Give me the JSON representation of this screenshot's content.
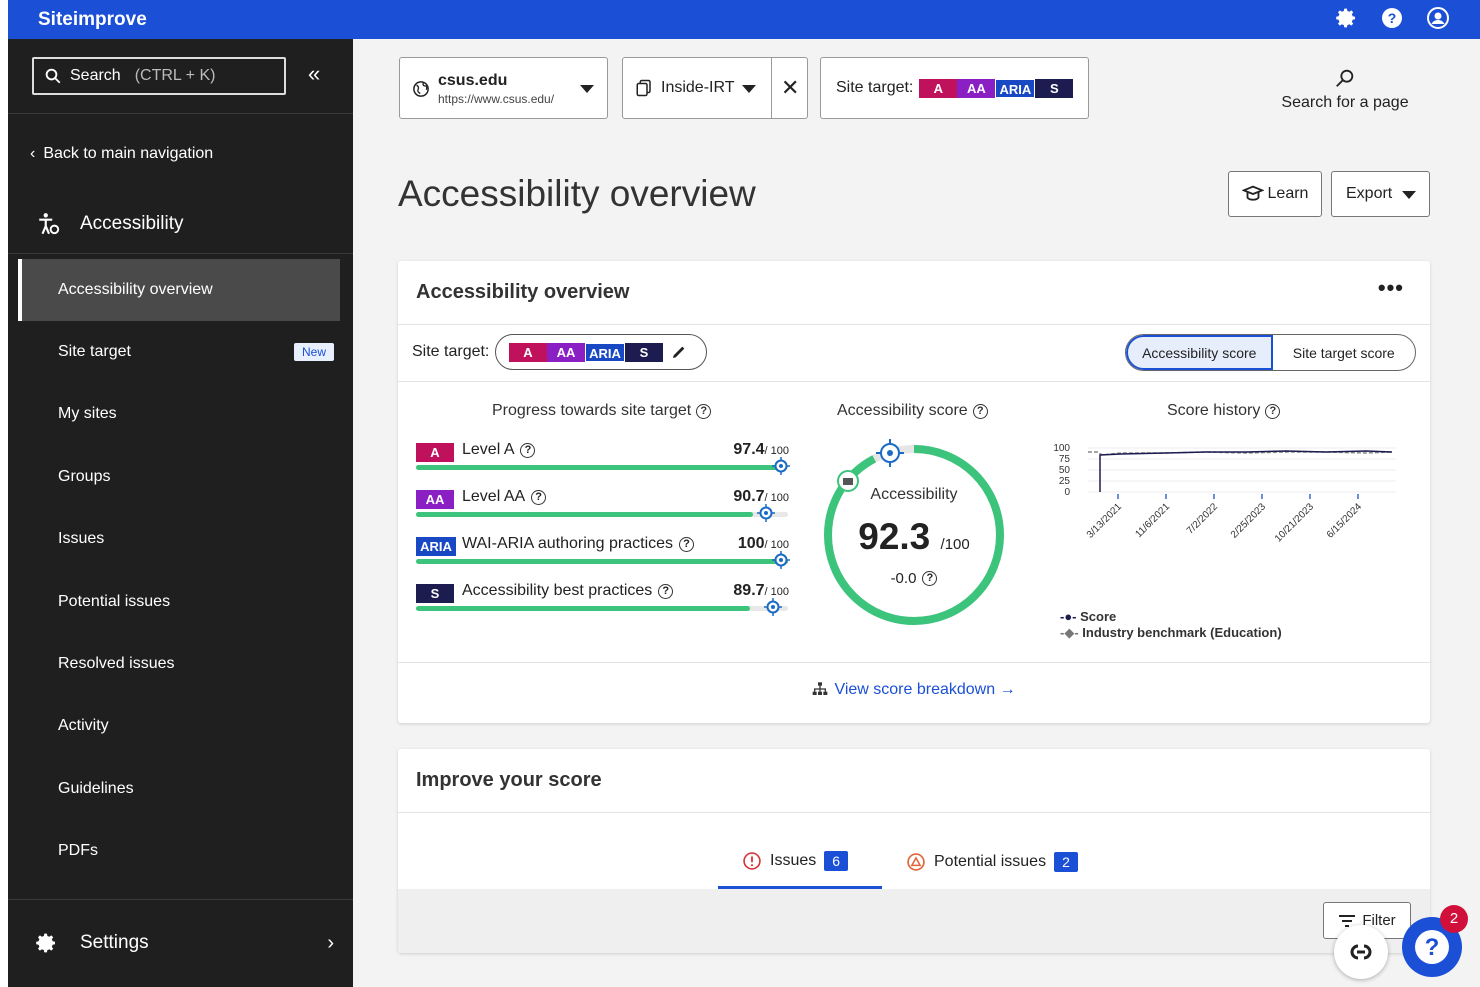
{
  "app": {
    "brand": "Siteimprove"
  },
  "topbar": {
    "icons": [
      "gear-icon",
      "help-icon",
      "account-icon"
    ]
  },
  "sidebar": {
    "search_label": "Search",
    "search_hint": "(CTRL + K)",
    "back_label": "Back to main navigation",
    "section_title": "Accessibility",
    "items": [
      {
        "label": "Accessibility overview",
        "active": true
      },
      {
        "label": "Site target",
        "badge": "New"
      },
      {
        "label": "My sites"
      },
      {
        "label": "Groups"
      },
      {
        "label": "Issues"
      },
      {
        "label": "Potential issues"
      },
      {
        "label": "Resolved issues"
      },
      {
        "label": "Activity"
      },
      {
        "label": "Guidelines"
      },
      {
        "label": "PDFs"
      }
    ],
    "settings_label": "Settings"
  },
  "header": {
    "site_name": "csus.edu",
    "site_url": "https://www.csus.edu/",
    "group_name": "Inside-IRT",
    "site_target_label": "Site target:",
    "tags": [
      "A",
      "AA",
      "ARIA",
      "S"
    ],
    "search_page": "Search for a page"
  },
  "page": {
    "title": "Accessibility overview",
    "learn_label": "Learn",
    "export_label": "Export"
  },
  "overview_card": {
    "title": "Accessibility overview",
    "more": "•••",
    "site_target_label": "Site target:",
    "toggle": [
      "Accessibility score",
      "Site target score"
    ],
    "progress_title": "Progress towards site target",
    "progress": [
      {
        "tag": "A",
        "label": "Level A",
        "value": "97.4",
        "max": "/ 100",
        "fraction": 0.974,
        "target": 0.98
      },
      {
        "tag": "AA",
        "label": "Level AA",
        "value": "90.7",
        "max": "/ 100",
        "fraction": 0.907,
        "target": 0.94
      },
      {
        "tag": "ARIA",
        "label": "WAI-ARIA authoring practices",
        "value": "100",
        "max": "/ 100",
        "fraction": 1.0,
        "target": 0.98
      },
      {
        "tag": "S",
        "label": "Accessibility best practices",
        "value": "89.7",
        "max": "/ 100",
        "fraction": 0.897,
        "target": 0.96
      }
    ],
    "score_title": "Accessibility score",
    "score_caption": "Accessibility",
    "score_value": "92.3",
    "score_max": "/100",
    "score_fraction": 0.923,
    "score_delta": "-0.0",
    "history_title": "Score history",
    "history_y_ticks": [
      "100",
      "75",
      "50",
      "25",
      "0"
    ],
    "history_x_ticks": [
      "3/13/2021",
      "11/6/2021",
      "7/2/2022",
      "2/25/2023",
      "10/21/2023",
      "6/15/2024"
    ],
    "legend": [
      "Score",
      "Industry benchmark (Education)"
    ],
    "view_link": "View score breakdown →"
  },
  "improve_card": {
    "title": "Improve your score",
    "tabs": [
      {
        "label": "Issues",
        "count": "6"
      },
      {
        "label": "Potential issues",
        "count": "2"
      }
    ],
    "filter_label": "Filter"
  },
  "fab": {
    "badge": "2"
  },
  "colors": {
    "brand": "#1b4fd6",
    "tag_a": "#c0115c",
    "tag_aa": "#8a1fc4",
    "tag_aria": "#1848c4",
    "tag_s": "#1c1c50",
    "progress": "#3cc47c"
  }
}
